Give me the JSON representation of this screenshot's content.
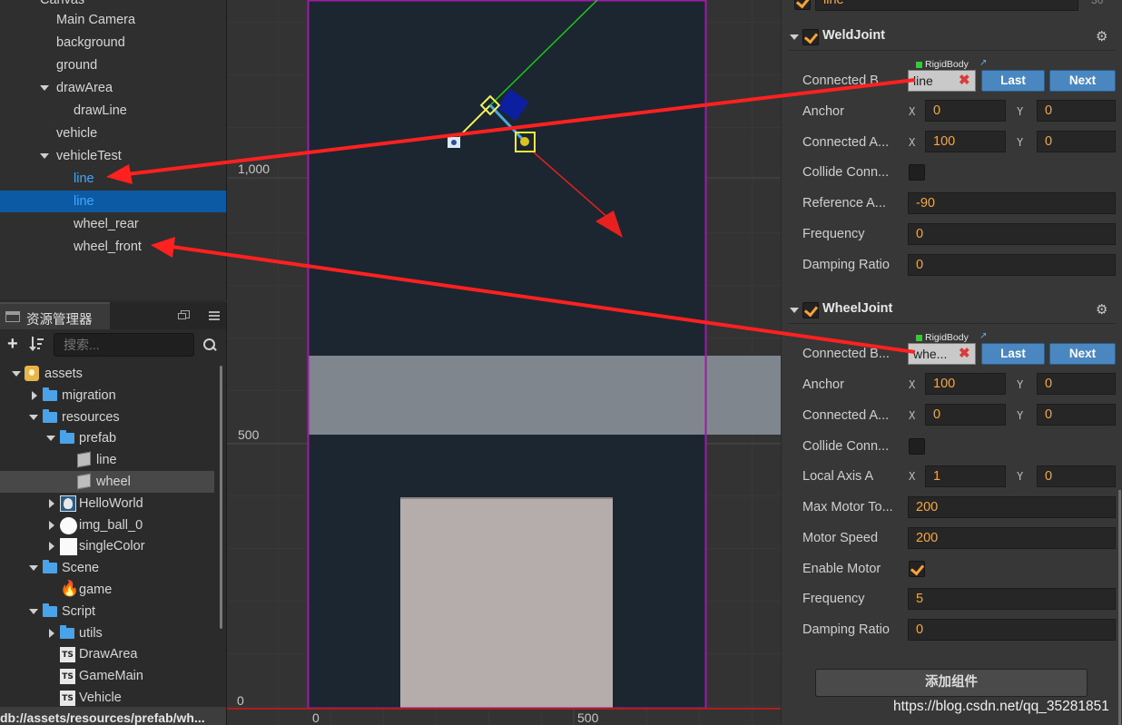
{
  "hierarchy": {
    "root_partial": "Canvas",
    "items": [
      {
        "label": "Main Camera",
        "depth": 1
      },
      {
        "label": "background",
        "depth": 1
      },
      {
        "label": "ground",
        "depth": 1
      },
      {
        "label": "drawArea",
        "depth": 1,
        "expanded": true
      },
      {
        "label": "drawLine",
        "depth": 2
      },
      {
        "label": "vehicle",
        "depth": 1
      },
      {
        "label": "vehicleTest",
        "depth": 1,
        "expanded": true
      },
      {
        "label": "line",
        "depth": 2,
        "highlight": true
      },
      {
        "label": "line",
        "depth": 2,
        "selected": true
      },
      {
        "label": "wheel_rear",
        "depth": 2
      },
      {
        "label": "wheel_front",
        "depth": 2
      }
    ]
  },
  "assets_panel": {
    "title": "资源管理器",
    "search_placeholder": "搜索...",
    "tree": [
      {
        "label": "assets",
        "depth": 0,
        "kind": "db",
        "open": true
      },
      {
        "label": "migration",
        "depth": 1,
        "kind": "folder",
        "open": false
      },
      {
        "label": "resources",
        "depth": 1,
        "kind": "folder",
        "open": true
      },
      {
        "label": "prefab",
        "depth": 2,
        "kind": "folder",
        "open": true
      },
      {
        "label": "line",
        "depth": 3,
        "kind": "prefab"
      },
      {
        "label": "wheel",
        "depth": 3,
        "kind": "prefab",
        "selected": true
      },
      {
        "label": "HelloWorld",
        "depth": 2,
        "kind": "image-face",
        "open": false
      },
      {
        "label": "img_ball_0",
        "depth": 2,
        "kind": "image-ball",
        "open": false
      },
      {
        "label": "singleColor",
        "depth": 2,
        "kind": "image-white",
        "open": false
      },
      {
        "label": "Scene",
        "depth": 1,
        "kind": "folder",
        "open": true
      },
      {
        "label": "game",
        "depth": 2,
        "kind": "scene-fire"
      },
      {
        "label": "Script",
        "depth": 1,
        "kind": "folder",
        "open": true
      },
      {
        "label": "utils",
        "depth": 2,
        "kind": "folder",
        "open": false
      },
      {
        "label": "DrawArea",
        "depth": 2,
        "kind": "ts"
      },
      {
        "label": "GameMain",
        "depth": 2,
        "kind": "ts"
      },
      {
        "label": "Vehicle",
        "depth": 2,
        "kind": "ts"
      }
    ],
    "status_path": "db://assets/resources/prefab/wh..."
  },
  "scene": {
    "y_labels": [
      "1,000",
      "500",
      "0"
    ],
    "x_labels": [
      "0",
      "500"
    ]
  },
  "inspector": {
    "top_field_partial": "line",
    "top_right_partial": "36",
    "weld": {
      "title": "WeldJoint",
      "rigidbody_tag": "RigidBody",
      "connected_body_label": "Connected B...",
      "connected_body_value": "line",
      "last": "Last",
      "next": "Next",
      "anchor_label": "Anchor",
      "anchor_x": "0",
      "anchor_y": "0",
      "connected_anchor_label": "Connected A...",
      "connected_anchor_x": "100",
      "connected_anchor_y": "0",
      "collide_label": "Collide Conn...",
      "collide_checked": false,
      "reference_label": "Reference A...",
      "reference_value": "-90",
      "frequency_label": "Frequency",
      "frequency_value": "0",
      "damping_label": "Damping Ratio",
      "damping_value": "0"
    },
    "wheel": {
      "title": "WheelJoint",
      "rigidbody_tag": "RigidBody",
      "connected_body_label": "Connected B...",
      "connected_body_value": "whe...",
      "last": "Last",
      "next": "Next",
      "anchor_label": "Anchor",
      "anchor_x": "100",
      "anchor_y": "0",
      "connected_anchor_label": "Connected A...",
      "connected_anchor_x": "0",
      "connected_anchor_y": "0",
      "collide_label": "Collide Conn...",
      "collide_checked": false,
      "local_axis_label": "Local Axis A",
      "local_axis_x": "1",
      "local_axis_y": "0",
      "max_motor_label": "Max Motor To...",
      "max_motor_value": "200",
      "motor_speed_label": "Motor Speed",
      "motor_speed_value": "200",
      "enable_motor_label": "Enable Motor",
      "enable_motor_checked": true,
      "frequency_label": "Frequency",
      "frequency_value": "5",
      "damping_label": "Damping Ratio",
      "damping_value": "0"
    },
    "axis_x": "X",
    "axis_y": "Y",
    "add_component": "添加组件"
  },
  "watermark": "https://blog.csdn.net/qq_35281851",
  "colors": {
    "selection": "#0b5aa3",
    "highlight_text": "#3ea8ff",
    "value_orange": "#f5a742",
    "button_blue": "#4a87c1",
    "canvas_border": "#a019a8",
    "annotation_red": "#ff2020"
  }
}
